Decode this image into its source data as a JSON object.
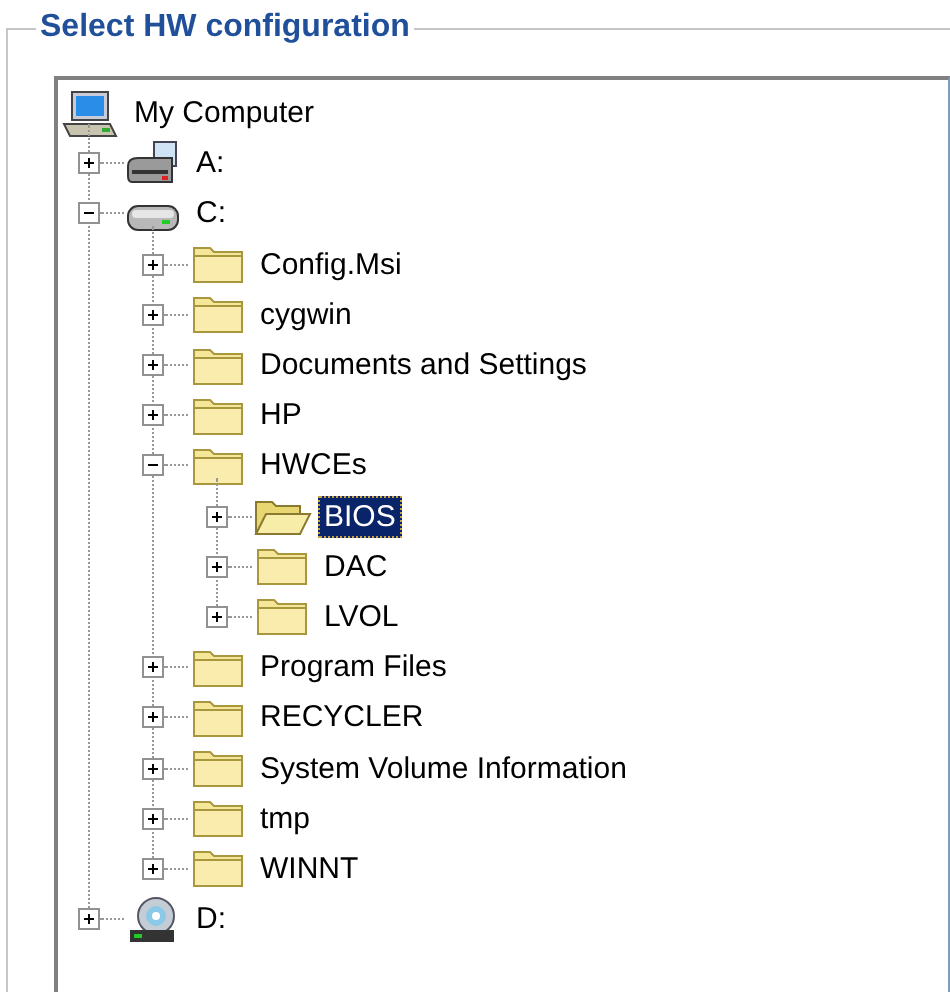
{
  "group_title": "Select HW configuration",
  "tree": [
    {
      "label": "My Computer",
      "kind": "computer",
      "selected": false,
      "children": [
        {
          "label": "A:",
          "kind": "floppy",
          "expanded": false,
          "selected": false
        },
        {
          "label": "C:",
          "kind": "drive",
          "expanded": true,
          "selected": false,
          "children": [
            {
              "label": "Config.Msi",
              "kind": "folder",
              "expanded": false,
              "selected": false
            },
            {
              "label": "cygwin",
              "kind": "folder",
              "expanded": false,
              "selected": false
            },
            {
              "label": "Documents and Settings",
              "kind": "folder",
              "expanded": false,
              "selected": false
            },
            {
              "label": "HP",
              "kind": "folder",
              "expanded": false,
              "selected": false
            },
            {
              "label": "HWCEs",
              "kind": "folder",
              "expanded": true,
              "selected": false,
              "children": [
                {
                  "label": "BIOS",
                  "kind": "folder",
                  "expanded": false,
                  "selected": true
                },
                {
                  "label": "DAC",
                  "kind": "folder",
                  "expanded": false,
                  "selected": false
                },
                {
                  "label": "LVOL",
                  "kind": "folder",
                  "expanded": false,
                  "selected": false
                }
              ]
            },
            {
              "label": "Program Files",
              "kind": "folder",
              "expanded": false,
              "selected": false
            },
            {
              "label": "RECYCLER",
              "kind": "folder",
              "expanded": false,
              "selected": false
            },
            {
              "label": "System Volume Information",
              "kind": "folder",
              "expanded": false,
              "selected": false
            },
            {
              "label": "tmp",
              "kind": "folder",
              "expanded": false,
              "selected": false
            },
            {
              "label": "WINNT",
              "kind": "folder",
              "expanded": false,
              "selected": false
            }
          ]
        },
        {
          "label": "D:",
          "kind": "cdrom",
          "expanded": false,
          "selected": false
        }
      ]
    }
  ]
}
